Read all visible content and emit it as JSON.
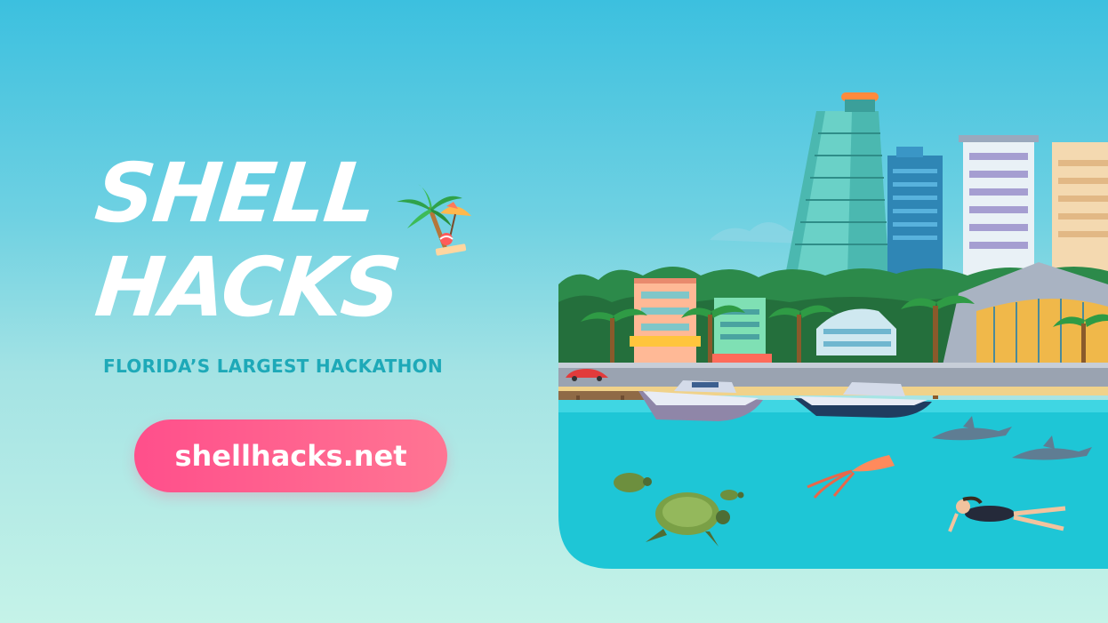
{
  "logo": {
    "line1": "SHELL",
    "line2": "HACKS",
    "icon": "palm-tree-beach-umbrella-icon"
  },
  "tagline": "FLORIDA’S LARGEST HACKATHON",
  "link_button": {
    "label": "shellhacks.net"
  },
  "illustration": {
    "subject": "miami-waterfront-skyline",
    "elements": [
      "skyscraper",
      "hotel-building",
      "palm-tree",
      "boat",
      "dolphin",
      "squid",
      "sea-turtle",
      "swimmer"
    ]
  },
  "colors": {
    "background_top": "#3cc0df",
    "background_bottom": "#c5f3e8",
    "tagline": "#1ea9b8",
    "button_start": "#ff4f8b",
    "button_end": "#ff7593",
    "water": "#1ec6d6"
  }
}
